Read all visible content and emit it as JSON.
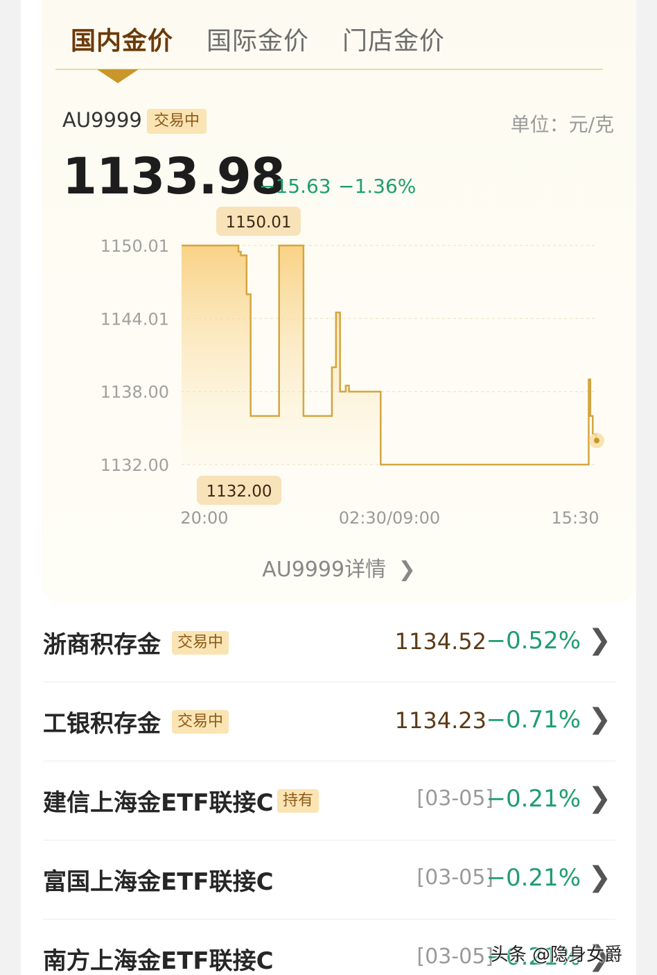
{
  "tabs": [
    {
      "label": "国内金价",
      "active": true
    },
    {
      "label": "国际金价",
      "active": false
    },
    {
      "label": "门店金价",
      "active": false
    }
  ],
  "quote": {
    "code": "AU9999",
    "status": "交易中",
    "unit": "单位：元/克",
    "price": "1133.98",
    "change": "−15.63",
    "change_pct": "−1.36%"
  },
  "chart_data": {
    "type": "line",
    "y_ticks": [
      "1150.01",
      "1144.01",
      "1138.00",
      "1132.00"
    ],
    "x_ticks": [
      "20:00",
      "02:30/09:00",
      "15:30"
    ],
    "ylim": [
      1132.0,
      1150.01
    ],
    "high_label": "1150.01",
    "low_label": "1132.00",
    "series": [
      {
        "x": [
          0,
          2,
          6,
          7,
          7.3,
          8,
          8.5,
          9,
          11,
          12,
          15,
          17,
          18.5,
          19,
          19.5,
          20,
          20.2,
          20.6,
          24.4,
          24.5,
          50.0,
          50.1,
          50.3,
          50.6,
          51
        ],
        "y": [
          1150.01,
          1150.01,
          1150.01,
          1149.5,
          1149.2,
          1146.0,
          1136.0,
          1136.0,
          1136.0,
          1150.01,
          1136.0,
          1136.0,
          1140.0,
          1144.5,
          1138.0,
          1138.0,
          1138.5,
          1138.0,
          1138.0,
          1132.0,
          1132.0,
          1139.0,
          1136.0,
          1134.5,
          1133.98
        ]
      }
    ],
    "accent": "#c9962b"
  },
  "detail_link": "AU9999详情",
  "products": [
    {
      "name": "浙商积存金",
      "badge": "交易中",
      "value": "1134.52",
      "date": "",
      "pct": "−0.52%"
    },
    {
      "name": "工银积存金",
      "badge": "交易中",
      "value": "1134.23",
      "date": "",
      "pct": "−0.71%"
    },
    {
      "name": "建信上海金ETF联接C",
      "badge": "持有",
      "value": "",
      "date": "[03-05]",
      "pct": "−0.21%"
    },
    {
      "name": "富国上海金ETF联接C",
      "badge": "",
      "value": "",
      "date": "[03-05]",
      "pct": "−0.21%"
    },
    {
      "name": "南方上海金ETF联接C",
      "badge": "",
      "value": "",
      "date": "[03-05]",
      "pct": "−0.21%"
    }
  ],
  "watermark": "头条 @隐身女爵",
  "colors": {
    "up_down_green": "#1f9d6f",
    "gold": "#c9962b",
    "brown": "#6b3a0a"
  }
}
